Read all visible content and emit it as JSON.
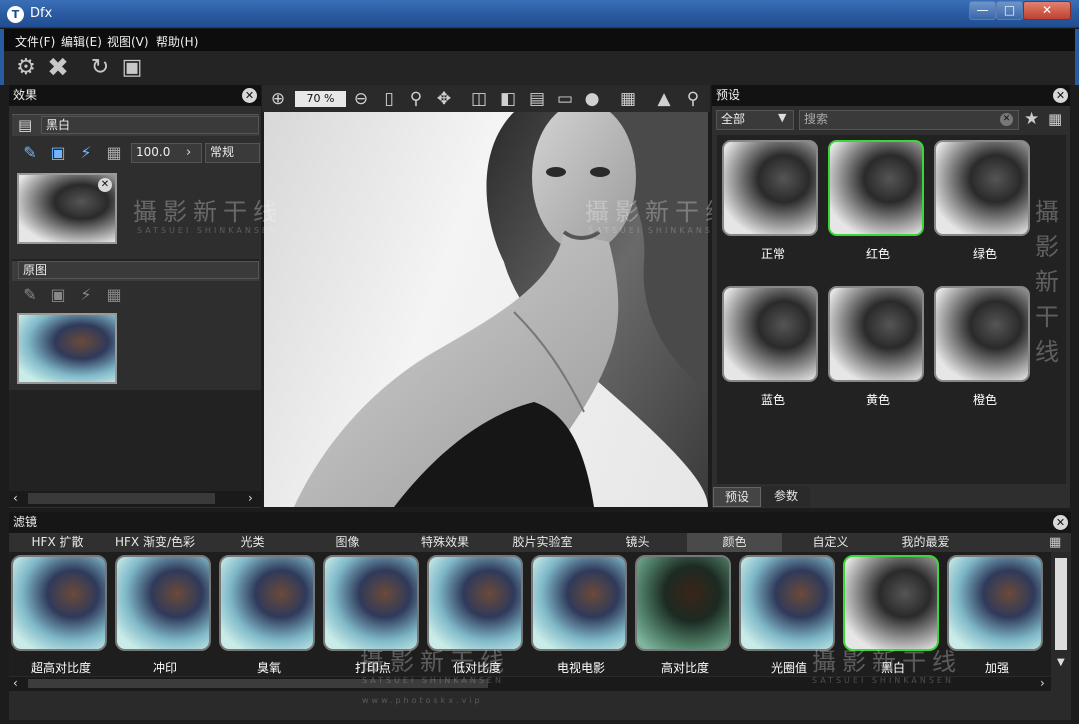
{
  "window": {
    "title": "Dfx",
    "logo": "T"
  },
  "menu": [
    "文件(F)",
    "编辑(E)",
    "视图(V)",
    "帮助(H)"
  ],
  "toolbar_icons": [
    "gear-icon",
    "close-icon",
    "refresh-icon",
    "fit-icon"
  ],
  "left_panel": {
    "title": "效果",
    "effect_layer": {
      "name": "黑白",
      "amount": "100.0",
      "blend_mode": "常规"
    },
    "original_layer": {
      "name": "原图"
    }
  },
  "center": {
    "zoom": "70 %"
  },
  "right_panel": {
    "title": "预设",
    "category_select": "全部",
    "search_placeholder": "搜索",
    "presets": [
      "正常",
      "红色",
      "绿色",
      "蓝色",
      "黄色",
      "橙色"
    ],
    "selected_preset": "红色",
    "tabs": [
      "预设",
      "参数"
    ]
  },
  "filters": {
    "title": "滤镜",
    "categories": [
      "HFX 扩散",
      "HFX 渐变/色彩",
      "光类",
      "图像",
      "特殊效果",
      "胶片实验室",
      "镜头",
      "颜色",
      "自定义",
      "我的最爱"
    ],
    "selected_category": "颜色",
    "items": [
      "超高对比度",
      "冲印",
      "臭氧",
      "打印点",
      "低对比度",
      "电视电影",
      "高对比度",
      "光圈值",
      "黑白",
      "加强"
    ],
    "selected_item": "黑白"
  },
  "watermarks": {
    "main": "攝影新干线",
    "sub": "SATSUEI SHINKANSEN",
    "url": "www.photoskx.vip"
  }
}
